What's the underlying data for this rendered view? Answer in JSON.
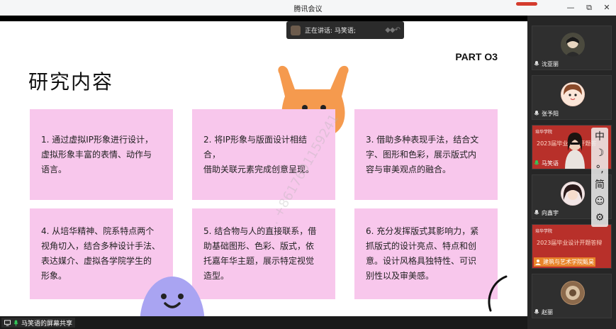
{
  "window": {
    "title": "腾讯会议",
    "controls": {
      "minimize": "—",
      "restore": "⧉",
      "close": "✕"
    }
  },
  "speaking_toast": {
    "text": "正在讲话: 马笑语;"
  },
  "slide": {
    "part": "PART O3",
    "title": "研究内容",
    "cards": [
      {
        "lines": [
          "1. 通过虚拟IP形象进行设计，",
          "虚拟形象丰富的表情、动作与",
          "语言。"
        ]
      },
      {
        "lines": [
          "2. 将IP形象与版面设计相结合，",
          "借助关联元素完成创意呈现。"
        ]
      },
      {
        "lines": [
          "3. 借助多种表现手法，结合文",
          "字、图形和色彩，展示版式内",
          "容与审美观点的融合。"
        ]
      },
      {
        "lines": [
          "4. 从培华精神、院系特点两个",
          "视角切入，结合多种设计手法、",
          "表达媒介、虚拟各学院学生的",
          "形象。"
        ]
      },
      {
        "lines": [
          "5. 结合物与人的直接联系，借",
          "助基础图形、色彩、版式，依",
          "托嘉年华主题，展示特定视觉",
          "造型。"
        ]
      },
      {
        "lines": [
          "6. 充分发挥版式其影响力，紧",
          "抓版式的设计亮点、特点和创",
          "意。设计风格具独特性、可识",
          "别性以及审美感。"
        ]
      }
    ],
    "watermark": "…  +8617691159241",
    "colors": {
      "card_bg": "#f8c7ec",
      "orange_mascot": "#f59a4e",
      "blue_mascot": "#a9a4f2"
    }
  },
  "share_label": {
    "text": "马笑语的屏幕共享"
  },
  "participants": [
    {
      "name": "沈亚丽"
    },
    {
      "name": "张予阳"
    },
    {
      "name": "马笑语",
      "video_title": "2023届毕业设计开题答",
      "video_top": "培华学院"
    },
    {
      "name": "向鑫宇"
    },
    {
      "name": "建筑与艺术学院甄昊",
      "video_title": "2023届毕业设计开题答辩",
      "video_top": "培华学院"
    },
    {
      "name": "赵丽"
    }
  ],
  "side_tools": [
    "中",
    "☽",
    "°,",
    "简",
    "☺",
    "⚙"
  ],
  "icons": [
    "minimize-icon",
    "restore-icon",
    "close-icon",
    "microphone-icon",
    "screen-share-icon",
    "settings-icon",
    "emoji-icon",
    "moon-icon"
  ]
}
